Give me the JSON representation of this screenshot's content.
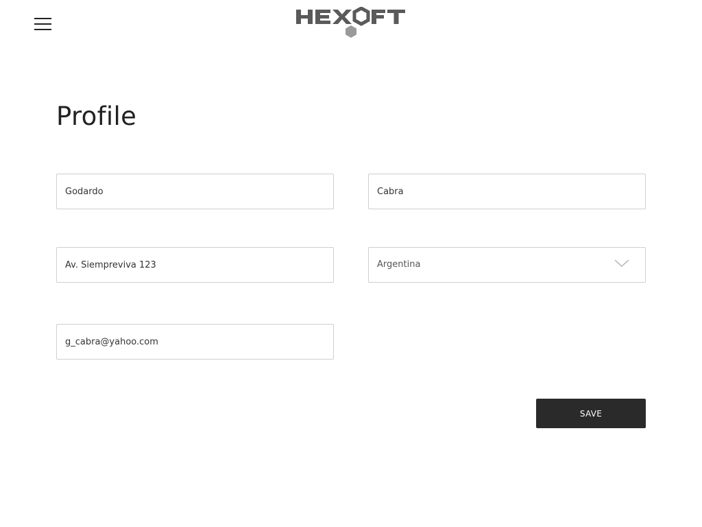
{
  "header": {
    "menu_icon": "hamburger-menu-icon",
    "logo_text": "HEXOFT",
    "logo_color": "#5a5a5a"
  },
  "page": {
    "title": "Profile"
  },
  "form": {
    "first_name": "Godardo",
    "last_name": "Cabra",
    "address": "Av. Siempreviva 123",
    "country": {
      "selected": "Argentina",
      "icon": "chevron-down-icon"
    },
    "email": "g_cabra@yahoo.com",
    "save_label": "SAVE"
  },
  "colors": {
    "button_bg": "#2a2a2a",
    "button_text": "#ffffff",
    "field_border": "#cfcfcf"
  }
}
